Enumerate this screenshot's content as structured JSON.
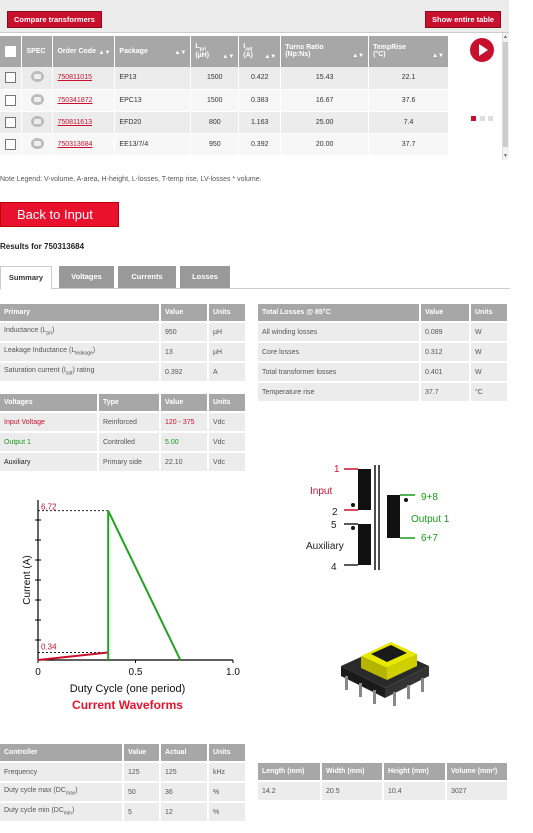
{
  "toolbar": {
    "compare_label": "Compare transformers",
    "show_all_label": "Show entire table"
  },
  "xf_table": {
    "headers": [
      "SPEC",
      "Order Code",
      "Package",
      "L_pri (µH)",
      "I_sat (A)",
      "Turns Ratio (Np:Ns)",
      "TempRise (°C)"
    ],
    "rows": [
      {
        "order_code": "750811015",
        "package": "EP13",
        "lpri": "1500",
        "isat": "0.422",
        "turns": "15.43",
        "temp": "22.1"
      },
      {
        "order_code": "750341872",
        "package": "EPC13",
        "lpri": "1500",
        "isat": "0.383",
        "turns": "16.67",
        "temp": "37.6"
      },
      {
        "order_code": "750811613",
        "package": "EFD20",
        "lpri": "800",
        "isat": "1.163",
        "turns": "25.00",
        "temp": "7.4"
      },
      {
        "order_code": "750313684",
        "package": "EE13/7/4",
        "lpri": "950",
        "isat": "0.392",
        "turns": "20.00",
        "temp": "37.7"
      }
    ]
  },
  "note": "Note Legend: V-volume, A-area, H-height, L-losses, T-temp rise, LV-losses * volume.",
  "back_label": "Back to Input",
  "results_title": "Results for 750313684",
  "tabs": [
    "Summary",
    "Voltages",
    "Currents",
    "Losses"
  ],
  "primary": {
    "headers": [
      "Primary",
      "Value",
      "Units"
    ],
    "rows": [
      {
        "label": "Inductance (L",
        "sub": "pri",
        "value": "950",
        "unit": "µH"
      },
      {
        "label": "Leakage Inductance (L",
        "sub": "leakage",
        "value": "13",
        "unit": "µH"
      },
      {
        "label": "Saturation current (I",
        "sub": "sat",
        "label_tail": ") rating",
        "value": "0.392",
        "unit": "A"
      }
    ]
  },
  "voltages": {
    "headers": [
      "Voltages",
      "Type",
      "Value",
      "Units"
    ],
    "rows": [
      {
        "label": "Input Voltage",
        "type": "Reinforced",
        "value": "120 - 375",
        "unit": "Vdc",
        "color": "#c8102e"
      },
      {
        "label": "Output 1",
        "type": "Controlled",
        "value": "5.00",
        "unit": "Vdc",
        "color": "#1a9a1a"
      },
      {
        "label": "Auxiliary",
        "type": "Primary side",
        "value": "22.10",
        "unit": "Vdc",
        "color": "#222222"
      }
    ]
  },
  "losses": {
    "headers": [
      "Total Losses @ 85°C",
      "Value",
      "Units"
    ],
    "rows": [
      {
        "label": "All winding losses",
        "value": "0.089",
        "unit": "W"
      },
      {
        "label": "Core losses",
        "value": "0.312",
        "unit": "W"
      },
      {
        "label": "Total transformer losses",
        "value": "0.401",
        "unit": "W"
      },
      {
        "label": "Temperature rise",
        "value": "37.7",
        "unit": "°C"
      }
    ]
  },
  "controller": {
    "headers": [
      "Controller",
      "Value",
      "Actual",
      "Units"
    ],
    "rows": [
      {
        "label": "Frequency",
        "value": "125",
        "actual": "125",
        "unit": "kHz"
      },
      {
        "label": "Duty cycle max (DC",
        "sub": "max",
        "value": "50",
        "actual": "36",
        "unit": "%"
      },
      {
        "label": "Duty cycle min (DC",
        "sub": "min",
        "value": "5",
        "actual": "12",
        "unit": "%"
      }
    ]
  },
  "dimensions": {
    "headers": [
      "Length (mm)",
      "Width (mm)",
      "Height (mm)",
      "Volume (mm³)"
    ],
    "values": [
      "14.2",
      "20.5",
      "10.4",
      "3027"
    ]
  },
  "schematic": {
    "pin1": "1",
    "pin2": "2",
    "pin5": "5",
    "pin4": "4",
    "pin98": "9+8",
    "pin67": "6+7",
    "input_label": "Input",
    "output_label": "Output 1",
    "aux_label": "Auxiliary"
  },
  "chart_data": {
    "type": "line",
    "title": "Current Waveforms",
    "xlabel": "Duty Cycle (one period)",
    "ylabel": "Current (A)",
    "xlim": [
      0,
      1.0
    ],
    "xticks": [
      "0",
      "0.5",
      "1.0"
    ],
    "ylim": [
      0,
      7.2
    ],
    "annotations": [
      "6.72",
      "0.34"
    ],
    "series": [
      {
        "x": [
          0,
          0.36
        ],
        "y": [
          0.0,
          0.34
        ],
        "color": "#c8102e"
      },
      {
        "x": [
          0.36,
          0.36,
          0.73
        ],
        "y": [
          0.0,
          6.72,
          0.0
        ],
        "color": "#22a322"
      }
    ]
  },
  "colors": {
    "accent": "#c8102e",
    "header_gray": "#a7a7a7",
    "row_gray": "#ececec"
  }
}
